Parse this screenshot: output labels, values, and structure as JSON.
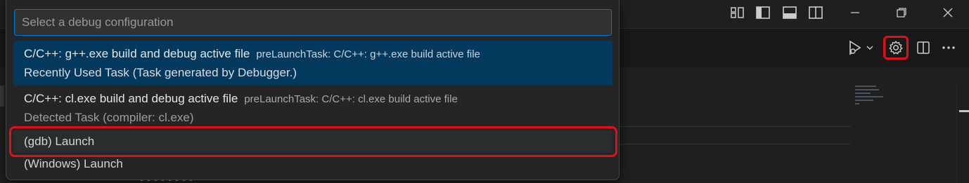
{
  "quick_pick": {
    "input": {
      "placeholder": "Select a debug configuration",
      "value": ""
    },
    "items": [
      {
        "label": "C/C++: g++.exe build and debug active file",
        "description": "preLaunchTask: C/C++: g++.exe build active file",
        "detail": "Recently Used Task (Task generated by Debugger.)"
      },
      {
        "label": "C/C++: cl.exe build and debug active file",
        "description": "preLaunchTask: C/C++: cl.exe build active file",
        "detail": "Detected Task (compiler: cl.exe)"
      },
      {
        "label": "(gdb) Launch"
      },
      {
        "label": "(Windows) Launch"
      }
    ]
  },
  "titlebar": {
    "icons": [
      "customize-layout-icon",
      "toggle-primary-sidebar-icon",
      "toggle-panel-icon",
      "toggle-secondary-sidebar-icon",
      "minimize-icon",
      "restore-icon",
      "close-icon"
    ]
  },
  "editor_actions": {
    "icons": [
      "run-debug-icon",
      "chevron-down-icon",
      "gear-icon",
      "split-editor-icon",
      "more-actions-icon"
    ]
  },
  "colors": {
    "highlight": "#e0101a",
    "selection": "#04395e",
    "focus_border": "#0078d4"
  }
}
